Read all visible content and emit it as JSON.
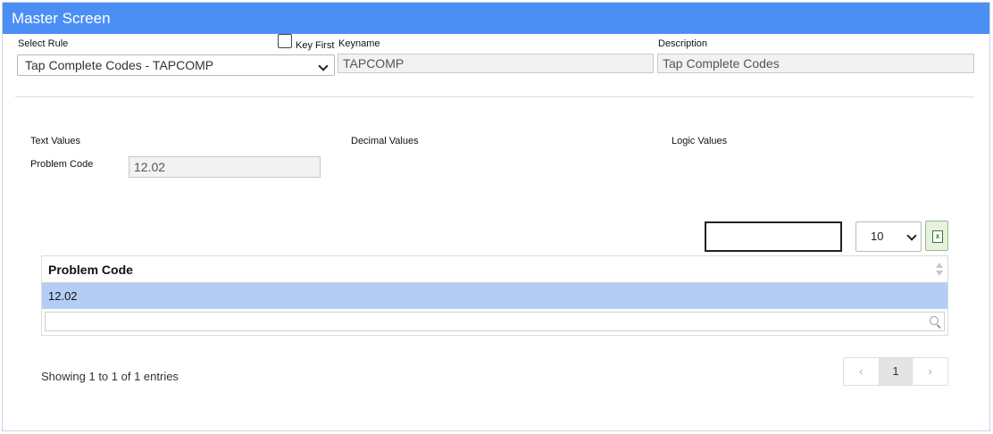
{
  "window": {
    "title": "Master Screen"
  },
  "rule": {
    "label": "Select Rule",
    "selected": "Tap Complete Codes - TAPCOMP",
    "key_first_label": "Key First",
    "key_first_checked": false
  },
  "keyname": {
    "label": "Keyname",
    "value": "TAPCOMP"
  },
  "description": {
    "label": "Description",
    "value": "Tap Complete Codes"
  },
  "sections": {
    "text_values": "Text Values",
    "decimal_values": "Decimal Values",
    "logic_values": "Logic Values"
  },
  "problem_code": {
    "label": "Problem Code",
    "value": "12.02"
  },
  "table": {
    "search_value": "",
    "page_size": "10",
    "export_icon": "excel-icon",
    "columns": [
      "Problem Code"
    ],
    "rows": [
      [
        "12.02"
      ]
    ],
    "info": "Showing 1 to 1 of 1 entries",
    "pager": {
      "prev": "‹",
      "current": "1",
      "next": "›"
    }
  },
  "colors": {
    "header": "#4b8ff5",
    "selected_row": "#b3cdf5"
  }
}
